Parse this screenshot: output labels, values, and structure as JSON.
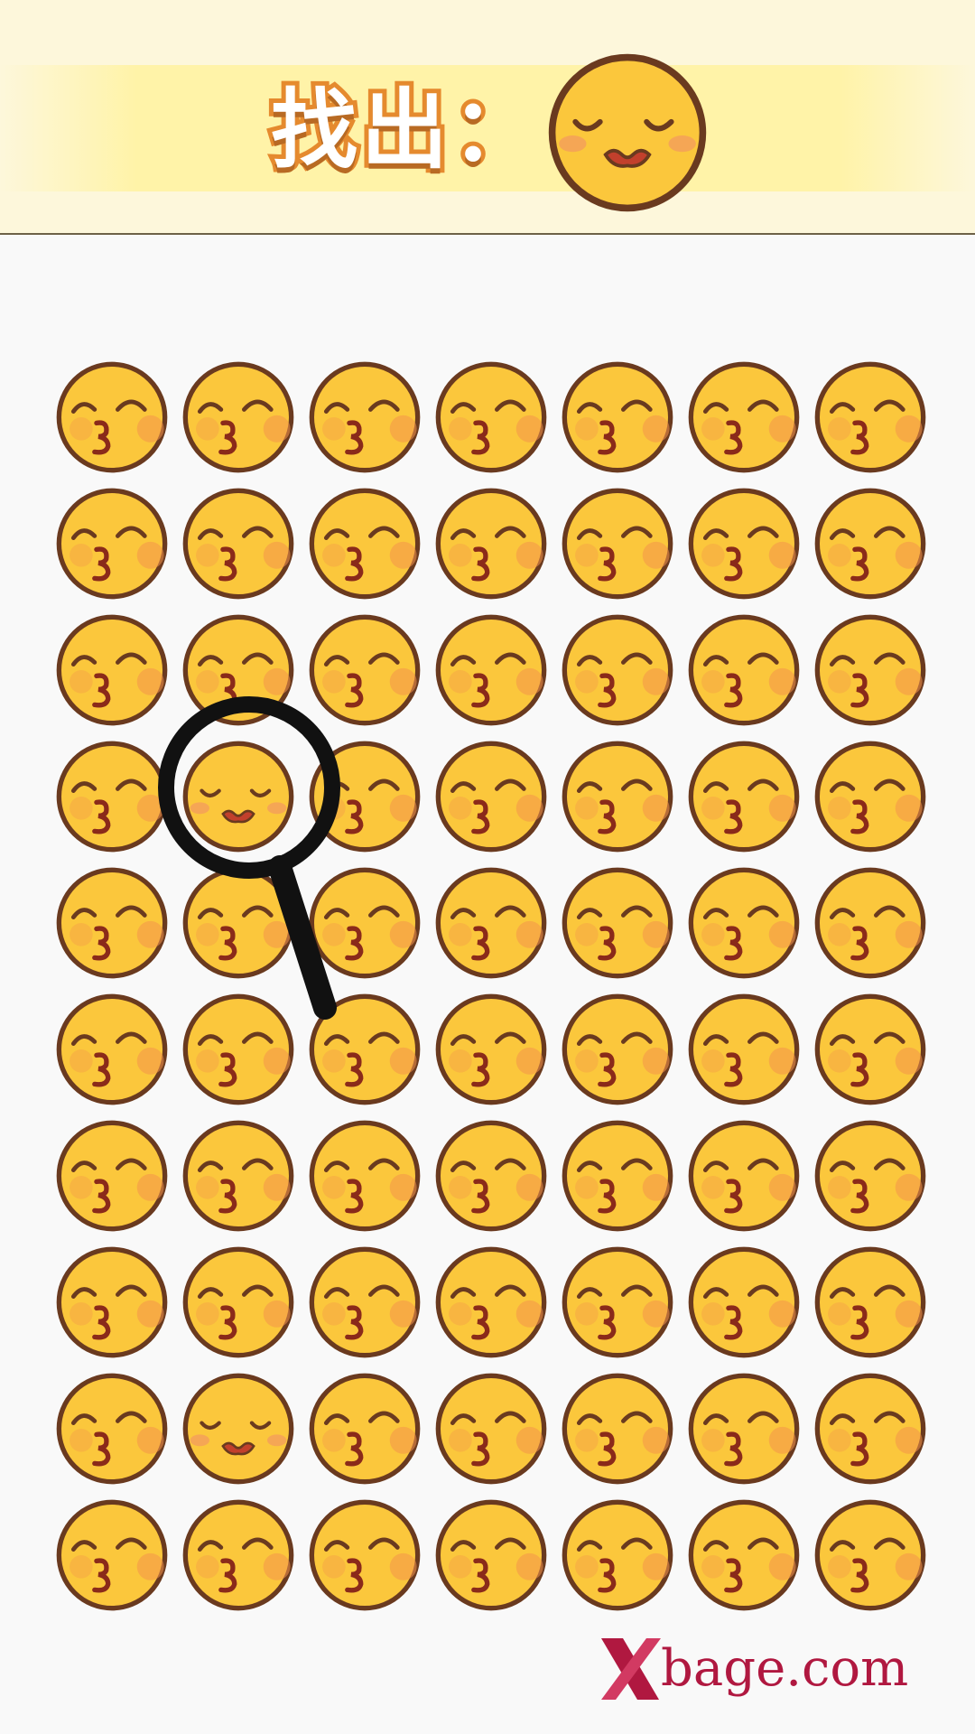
{
  "header": {
    "title": "找出：",
    "target_icon": "blushing-closed-eyes-smile-emoji"
  },
  "puzzle": {
    "rows": 10,
    "cols": 7,
    "common_icon": "kissing-face-emoji",
    "odd_icon": "blushing-closed-eyes-smile-emoji",
    "odd_cells": [
      [
        3,
        1
      ],
      [
        8,
        1
      ]
    ]
  },
  "magnifier": {
    "icon": "magnifying-glass-icon",
    "highlight_cell": [
      3,
      1
    ]
  },
  "watermark": {
    "text": "bage.com",
    "logo_letter": "X"
  },
  "colors": {
    "face": "#fbc73c",
    "face_outline": "#6a3a1f",
    "blush": "#f4944a",
    "title_stroke": "#e58a2e",
    "watermark": "#b01840"
  }
}
